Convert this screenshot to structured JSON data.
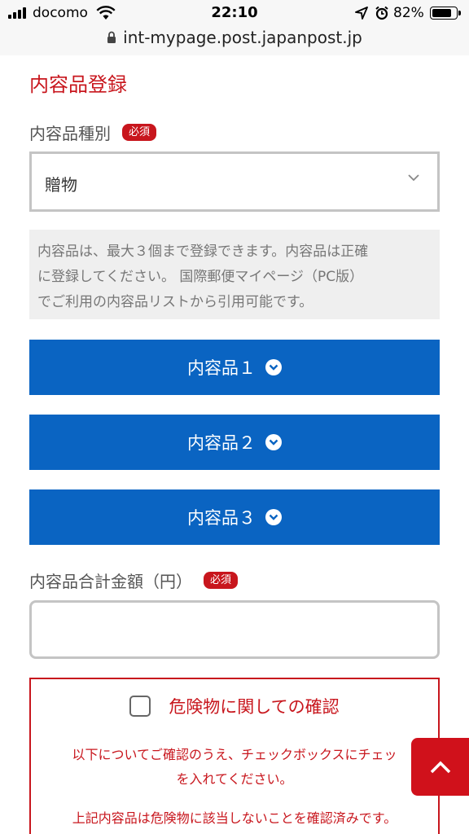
{
  "status_bar": {
    "carrier": "docomo",
    "time": "22:10",
    "battery_percent": "82%",
    "battery_level": 0.82,
    "icons": [
      "signal-icon",
      "wifi-icon",
      "location-arrow-icon",
      "alarm-icon",
      "battery-icon"
    ]
  },
  "browser": {
    "url": "int-mypage.post.japanpost.jp",
    "icons": [
      "lock-icon"
    ]
  },
  "section": {
    "title": "内容品登録"
  },
  "content_type": {
    "label": "内容品種別",
    "required_badge": "必須",
    "selected": "贈物"
  },
  "info": {
    "line1": "内容品は、最大３個まで登録できます。内容品は正確",
    "line2": "に登録してください。 国際郵便マイページ（PC版）",
    "line3": "でご利用の内容品リストから引用可能です。"
  },
  "items": [
    {
      "label": "内容品１"
    },
    {
      "label": "内容品２"
    },
    {
      "label": "内容品３"
    }
  ],
  "total": {
    "label": "内容品合計金額（円）",
    "required_badge": "必須",
    "value": ""
  },
  "danger": {
    "title": "危険物に関しての確認",
    "line1": "以下についてご確認のうえ、チェックボックスにチェッ",
    "line2": "を入れてください。",
    "line3": "上記内容品は危険物に該当しないことを確認済みです。"
  },
  "colors": {
    "accent_red": "#c8161d",
    "button_blue": "#0a64c2"
  }
}
